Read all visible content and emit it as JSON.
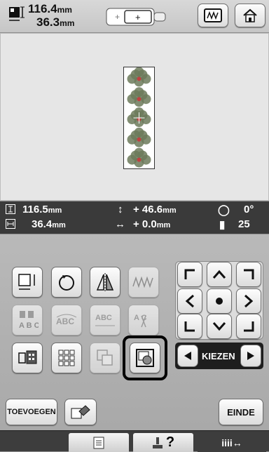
{
  "header": {
    "width_value": "116.4",
    "height_value": "36.3",
    "unit": "mm"
  },
  "info_bar": {
    "height_value": "116.5",
    "width_value": "36.4",
    "offset_y": "+  46.6",
    "offset_x": "+   0.0",
    "unit": "mm",
    "rotation": "0°",
    "count": "25"
  },
  "buttons": {
    "add_label": "TOEVOEGEN",
    "end_label": "EINDE",
    "select_label": "KIEZEN",
    "spacing_label": "iiii↔",
    "help_label": "?"
  },
  "pattern": {
    "repeat_count": 5
  },
  "colors": {
    "accent_highlight": "#000000",
    "motif_green": "#6c7a5a",
    "motif_red": "#c04040"
  }
}
